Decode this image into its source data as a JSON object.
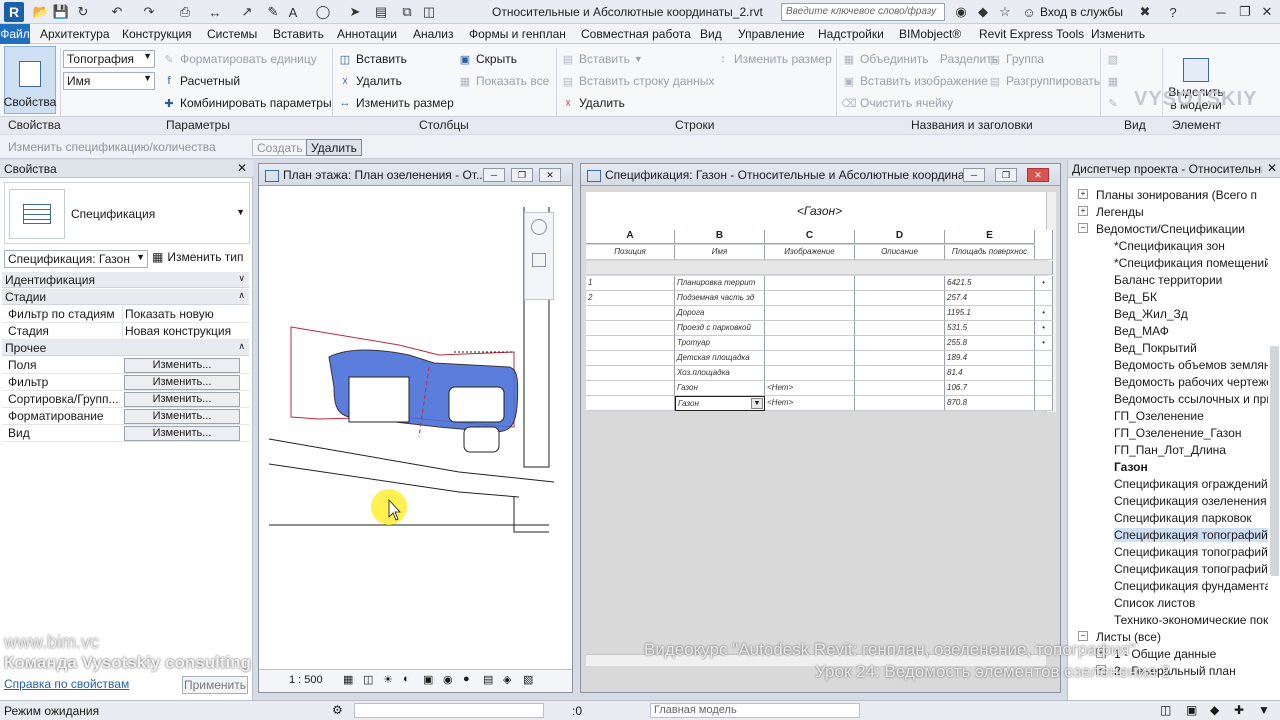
{
  "app": {
    "logo": "R",
    "document_title": "Относительные и Абсолютные координаты_2.rvt",
    "search_placeholder": "Введите ключевое слово/фразу",
    "login": "Вход в службы"
  },
  "menu": {
    "file": "Файл",
    "items": [
      "Архитектура",
      "Конструкция",
      "Системы",
      "Вставить",
      "Аннотации",
      "Анализ",
      "Формы и генплан",
      "Совместная работа",
      "Вид",
      "Управление",
      "Надстройки",
      "BIMobject®",
      "Revit Express Tools",
      "Изменить"
    ]
  },
  "ribbon": {
    "properties_button": "Свойства",
    "params": {
      "combo1": "Топография",
      "combo2": "Имя",
      "format_unit": "Форматировать единицу",
      "calculated": "Расчетный",
      "combine": "Комбинировать параметры"
    },
    "columns": {
      "insert": "Вставить",
      "delete": "Удалить",
      "resize": "Изменить размер",
      "hide": "Скрыть",
      "show_all": "Показать все"
    },
    "rows": {
      "insert": "Вставить",
      "insert_data_row": "Вставить строку данных",
      "delete": "Удалить",
      "resize": "Изменить размер"
    },
    "titles": {
      "merge": "Объединить",
      "unmerge": "Разделить",
      "insert_image": "Вставить изображение",
      "clear_cell": "Очистить ячейку",
      "group": "Группа",
      "ungroup": "Разгруппировать"
    },
    "element": {
      "highlight": "Выделить",
      "in_model": "в модели"
    },
    "group_labels": {
      "properties": "Свойства",
      "params": "Параметры",
      "columns": "Столбцы",
      "rows": "Строки",
      "titles": "Названия и заголовки",
      "view": "Вид",
      "element": "Элемент"
    }
  },
  "optbar": {
    "context": "Изменить спецификацию/количества",
    "create": "Создать",
    "delete": "Удалить"
  },
  "properties": {
    "header": "Свойства",
    "type_name": "Спецификация",
    "selector": "Спецификация: Газон",
    "edit_type": "Изменить тип",
    "cat_ident": "Идентификация",
    "cat_stages": "Стадии",
    "rows_stages": [
      {
        "k": "Фильтр по стадиям",
        "v": "Показать новую"
      },
      {
        "k": "Стадия",
        "v": "Новая конструкция"
      }
    ],
    "cat_other": "Прочее",
    "rows_other": [
      {
        "k": "Поля",
        "v": "Изменить..."
      },
      {
        "k": "Фильтр",
        "v": "Изменить..."
      },
      {
        "k": "Сортировка/Групп...",
        "v": "Изменить..."
      },
      {
        "k": "Форматирование",
        "v": "Изменить..."
      },
      {
        "k": "Вид",
        "v": "Изменить..."
      }
    ],
    "help": "Справка по свойствам",
    "apply": "Применить"
  },
  "plan_view": {
    "title": "План этажа: План озеленения - От...",
    "scale": "1 : 500"
  },
  "schedule": {
    "title": "Спецификация: Газон - Относительные и Абсолютные координат...",
    "name": "<Газон>",
    "letters": [
      "A",
      "B",
      "C",
      "D",
      "E"
    ],
    "headers": [
      "Позиция",
      "Имя",
      "Изображение",
      "Описание",
      "Площадь поверхнос"
    ],
    "rows": [
      [
        "1",
        "Планировка террит",
        "",
        "",
        "6421.5"
      ],
      [
        "2",
        "Подземная часть зд",
        "",
        "",
        "257.4"
      ],
      [
        "",
        "Дорога",
        "",
        "",
        "1195.1"
      ],
      [
        "",
        "Проезд с парковкой",
        "",
        "",
        "531.5"
      ],
      [
        "",
        "Тротуар",
        "",
        "",
        "255.8"
      ],
      [
        "",
        "Детская площадка",
        "",
        "",
        "189.4"
      ],
      [
        "",
        "Хоз.площадка",
        "",
        "",
        "81.4"
      ],
      [
        "",
        "Газон",
        "<Нет>",
        "",
        "106.7"
      ],
      [
        "",
        "Газон",
        "<Нет>",
        "",
        "870.8"
      ]
    ]
  },
  "project": {
    "header": "Диспетчер проекта - Относительны...",
    "items": [
      {
        "t": "Планы зонирования (Всего п",
        "lvl": 1,
        "exp": "+"
      },
      {
        "t": "Легенды",
        "lvl": 1,
        "exp": "+"
      },
      {
        "t": "Ведомости/Спецификации",
        "lvl": 1,
        "exp": "−"
      },
      {
        "t": "*Спецификация зон",
        "lvl": 2
      },
      {
        "t": "*Спецификация помещений",
        "lvl": 2
      },
      {
        "t": "Баланс территории",
        "lvl": 2
      },
      {
        "t": "Вед_БК",
        "lvl": 2
      },
      {
        "t": "Вед_Жил_Зд",
        "lvl": 2
      },
      {
        "t": "Вед_МАФ",
        "lvl": 2
      },
      {
        "t": "Вед_Покрытий",
        "lvl": 2
      },
      {
        "t": "Ведомость объемов земляны",
        "lvl": 2
      },
      {
        "t": "Ведомость рабочих чертеже",
        "lvl": 2
      },
      {
        "t": "Ведомость ссылочных и при",
        "lvl": 2
      },
      {
        "t": "ГП_Озеленение",
        "lvl": 2
      },
      {
        "t": "ГП_Озеленение_Газон",
        "lvl": 2
      },
      {
        "t": "ГП_Пан_Лот_Длина",
        "lvl": 2
      },
      {
        "t": "Газон",
        "lvl": 2,
        "bold": true
      },
      {
        "t": "Спецификация ограждений",
        "lvl": 2
      },
      {
        "t": "Спецификация озеленения",
        "lvl": 2
      },
      {
        "t": "Спецификация парковок",
        "lvl": 2
      },
      {
        "t": "Спецификация топографий",
        "lvl": 2,
        "sel": true
      },
      {
        "t": "Спецификация топографий в",
        "lvl": 2
      },
      {
        "t": "Спецификация топографий н",
        "lvl": 2
      },
      {
        "t": "Спецификация фундамента н",
        "lvl": 2
      },
      {
        "t": "Список листов",
        "lvl": 2
      },
      {
        "t": "Технико-экономические пока",
        "lvl": 2
      },
      {
        "t": "Листы (все)",
        "lvl": 1,
        "exp": "−"
      },
      {
        "t": "1 - Общие данные",
        "lvl": 2,
        "exp": "+"
      },
      {
        "t": "2 - Генеральный план",
        "lvl": 2,
        "exp": "+"
      }
    ]
  },
  "status": {
    "mode": "Режим ожидания",
    "count": ":0",
    "model": "Главная модель"
  },
  "watermark": {
    "site": "www.bim.vc",
    "team": "Команда Vysotskiy consulting",
    "course": "Видеокурс \"Autodesk Revit: генплан, озеленение, топография\"",
    "lesson": "Урок 24: Ведомость элементов озеленения 2",
    "brand": "VYSOTSKIY"
  },
  "colors": {
    "accent": "#1f6fbf",
    "lawn": "#4a6fd8",
    "selection": "#cfe0f5"
  }
}
